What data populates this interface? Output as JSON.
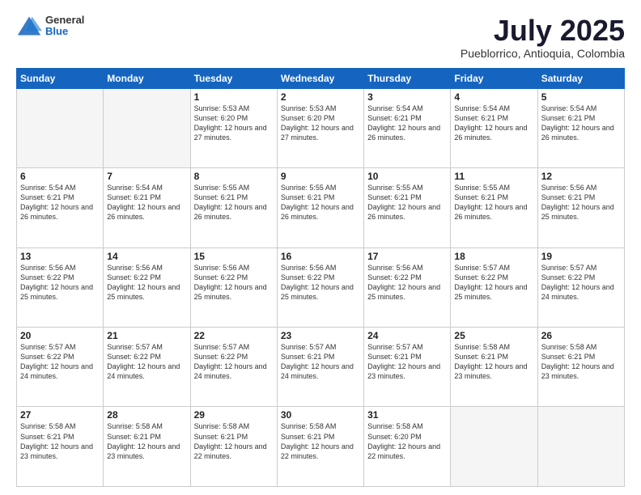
{
  "logo": {
    "general": "General",
    "blue": "Blue"
  },
  "header": {
    "month": "July 2025",
    "location": "Pueblorrico, Antioquia, Colombia"
  },
  "weekdays": [
    "Sunday",
    "Monday",
    "Tuesday",
    "Wednesday",
    "Thursday",
    "Friday",
    "Saturday"
  ],
  "weeks": [
    [
      {
        "day": "",
        "info": ""
      },
      {
        "day": "",
        "info": ""
      },
      {
        "day": "1",
        "info": "Sunrise: 5:53 AM\nSunset: 6:20 PM\nDaylight: 12 hours and 27 minutes."
      },
      {
        "day": "2",
        "info": "Sunrise: 5:53 AM\nSunset: 6:20 PM\nDaylight: 12 hours and 27 minutes."
      },
      {
        "day": "3",
        "info": "Sunrise: 5:54 AM\nSunset: 6:21 PM\nDaylight: 12 hours and 26 minutes."
      },
      {
        "day": "4",
        "info": "Sunrise: 5:54 AM\nSunset: 6:21 PM\nDaylight: 12 hours and 26 minutes."
      },
      {
        "day": "5",
        "info": "Sunrise: 5:54 AM\nSunset: 6:21 PM\nDaylight: 12 hours and 26 minutes."
      }
    ],
    [
      {
        "day": "6",
        "info": "Sunrise: 5:54 AM\nSunset: 6:21 PM\nDaylight: 12 hours and 26 minutes."
      },
      {
        "day": "7",
        "info": "Sunrise: 5:54 AM\nSunset: 6:21 PM\nDaylight: 12 hours and 26 minutes."
      },
      {
        "day": "8",
        "info": "Sunrise: 5:55 AM\nSunset: 6:21 PM\nDaylight: 12 hours and 26 minutes."
      },
      {
        "day": "9",
        "info": "Sunrise: 5:55 AM\nSunset: 6:21 PM\nDaylight: 12 hours and 26 minutes."
      },
      {
        "day": "10",
        "info": "Sunrise: 5:55 AM\nSunset: 6:21 PM\nDaylight: 12 hours and 26 minutes."
      },
      {
        "day": "11",
        "info": "Sunrise: 5:55 AM\nSunset: 6:21 PM\nDaylight: 12 hours and 26 minutes."
      },
      {
        "day": "12",
        "info": "Sunrise: 5:56 AM\nSunset: 6:21 PM\nDaylight: 12 hours and 25 minutes."
      }
    ],
    [
      {
        "day": "13",
        "info": "Sunrise: 5:56 AM\nSunset: 6:22 PM\nDaylight: 12 hours and 25 minutes."
      },
      {
        "day": "14",
        "info": "Sunrise: 5:56 AM\nSunset: 6:22 PM\nDaylight: 12 hours and 25 minutes."
      },
      {
        "day": "15",
        "info": "Sunrise: 5:56 AM\nSunset: 6:22 PM\nDaylight: 12 hours and 25 minutes."
      },
      {
        "day": "16",
        "info": "Sunrise: 5:56 AM\nSunset: 6:22 PM\nDaylight: 12 hours and 25 minutes."
      },
      {
        "day": "17",
        "info": "Sunrise: 5:56 AM\nSunset: 6:22 PM\nDaylight: 12 hours and 25 minutes."
      },
      {
        "day": "18",
        "info": "Sunrise: 5:57 AM\nSunset: 6:22 PM\nDaylight: 12 hours and 25 minutes."
      },
      {
        "day": "19",
        "info": "Sunrise: 5:57 AM\nSunset: 6:22 PM\nDaylight: 12 hours and 24 minutes."
      }
    ],
    [
      {
        "day": "20",
        "info": "Sunrise: 5:57 AM\nSunset: 6:22 PM\nDaylight: 12 hours and 24 minutes."
      },
      {
        "day": "21",
        "info": "Sunrise: 5:57 AM\nSunset: 6:22 PM\nDaylight: 12 hours and 24 minutes."
      },
      {
        "day": "22",
        "info": "Sunrise: 5:57 AM\nSunset: 6:22 PM\nDaylight: 12 hours and 24 minutes."
      },
      {
        "day": "23",
        "info": "Sunrise: 5:57 AM\nSunset: 6:21 PM\nDaylight: 12 hours and 24 minutes."
      },
      {
        "day": "24",
        "info": "Sunrise: 5:57 AM\nSunset: 6:21 PM\nDaylight: 12 hours and 23 minutes."
      },
      {
        "day": "25",
        "info": "Sunrise: 5:58 AM\nSunset: 6:21 PM\nDaylight: 12 hours and 23 minutes."
      },
      {
        "day": "26",
        "info": "Sunrise: 5:58 AM\nSunset: 6:21 PM\nDaylight: 12 hours and 23 minutes."
      }
    ],
    [
      {
        "day": "27",
        "info": "Sunrise: 5:58 AM\nSunset: 6:21 PM\nDaylight: 12 hours and 23 minutes."
      },
      {
        "day": "28",
        "info": "Sunrise: 5:58 AM\nSunset: 6:21 PM\nDaylight: 12 hours and 23 minutes."
      },
      {
        "day": "29",
        "info": "Sunrise: 5:58 AM\nSunset: 6:21 PM\nDaylight: 12 hours and 22 minutes."
      },
      {
        "day": "30",
        "info": "Sunrise: 5:58 AM\nSunset: 6:21 PM\nDaylight: 12 hours and 22 minutes."
      },
      {
        "day": "31",
        "info": "Sunrise: 5:58 AM\nSunset: 6:20 PM\nDaylight: 12 hours and 22 minutes."
      },
      {
        "day": "",
        "info": ""
      },
      {
        "day": "",
        "info": ""
      }
    ]
  ]
}
